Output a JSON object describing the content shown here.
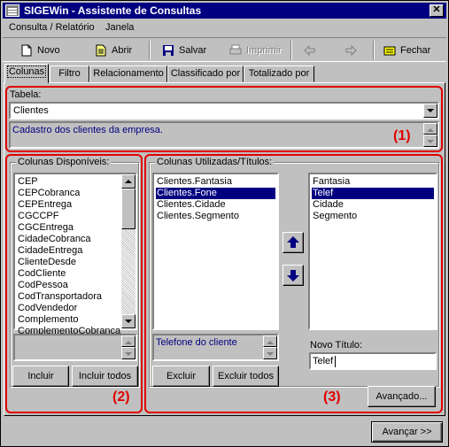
{
  "window": {
    "title": "SIGEWin - Assistente de Consultas"
  },
  "menu": [
    "Consulta / Relatório",
    "Janela"
  ],
  "toolbar": {
    "novo": "Novo",
    "abrir": "Abrir",
    "salvar": "Salvar",
    "imprimir": "Imprimir",
    "fechar": "Fechar"
  },
  "tabs": [
    "Colunas",
    "Filtro",
    "Relacionamento",
    "Classificado por",
    "Totalizado por"
  ],
  "tabela": {
    "label": "Tabela:",
    "value": "Clientes",
    "description": "Cadastro dos clientes da empresa.",
    "region_label": "(1)"
  },
  "disponiveis": {
    "title": "Colunas Disponíveis:",
    "items": [
      "CEP",
      "CEPCobranca",
      "CEPEntrega",
      "CGCCPF",
      "CGCEntrega",
      "CidadeCobranca",
      "CidadeEntrega",
      "ClienteDesde",
      "CodCliente",
      "CodPessoa",
      "CodTransportadora",
      "CodVendedor",
      "Complemento",
      "ComplementoCobranca"
    ],
    "incluir": "Incluir",
    "incluir_todos": "Incluir todos",
    "region_label": "(2)"
  },
  "utilizadas": {
    "title": "Colunas Utilizadas/Títulos:",
    "columns": [
      "Clientes.Fantasia",
      "Clientes.Fone",
      "Clientes.Cidade",
      "Clientes.Segmento"
    ],
    "selected_column": 1,
    "titles": [
      "Fantasia",
      "Telef",
      "Cidade",
      "Segmento"
    ],
    "selected_title": 1,
    "column_description": "Telefone do cliente",
    "excluir": "Excluir",
    "excluir_todos": "Excluir todos",
    "novo_titulo_label": "Novo Título:",
    "novo_titulo_value": "Telef",
    "avancado": "Avançado...",
    "region_label": "(3)"
  },
  "footer": {
    "avancar": "Avançar >>"
  },
  "colors": {
    "title_bar": "#000080",
    "highlight": "#e00000",
    "selection": "#000080"
  }
}
